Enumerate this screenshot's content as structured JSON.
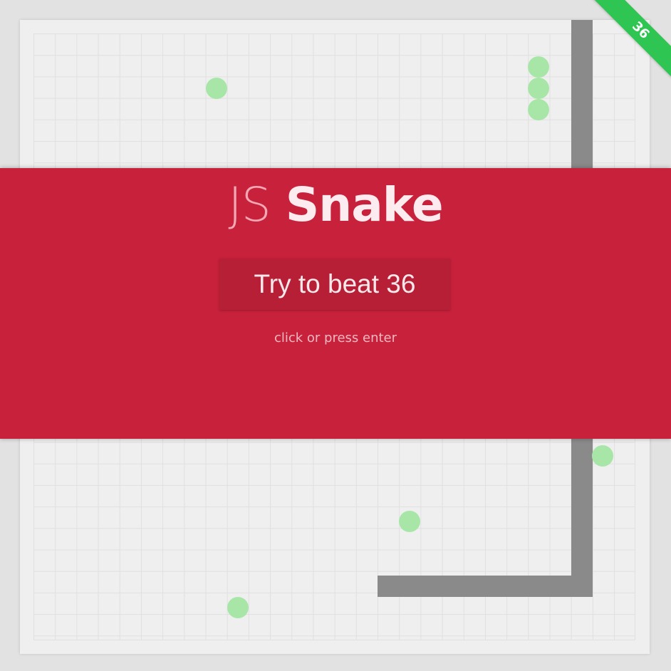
{
  "game": {
    "title_light": "JS",
    "title_bold": "Snake",
    "high_score": "36",
    "play_button_label": "Try to beat 36",
    "hint": "click or press enter"
  },
  "colors": {
    "background": "#e2e2e2",
    "board": "#efefef",
    "grid_line": "#e0e0e0",
    "snake": "#8a8a8a",
    "food": "#a8e6a8",
    "overlay": "#c8213b",
    "button": "#b71f36",
    "ribbon": "#2ec552"
  },
  "icons": {
    "food": "food-dot",
    "snake": "snake-body"
  }
}
